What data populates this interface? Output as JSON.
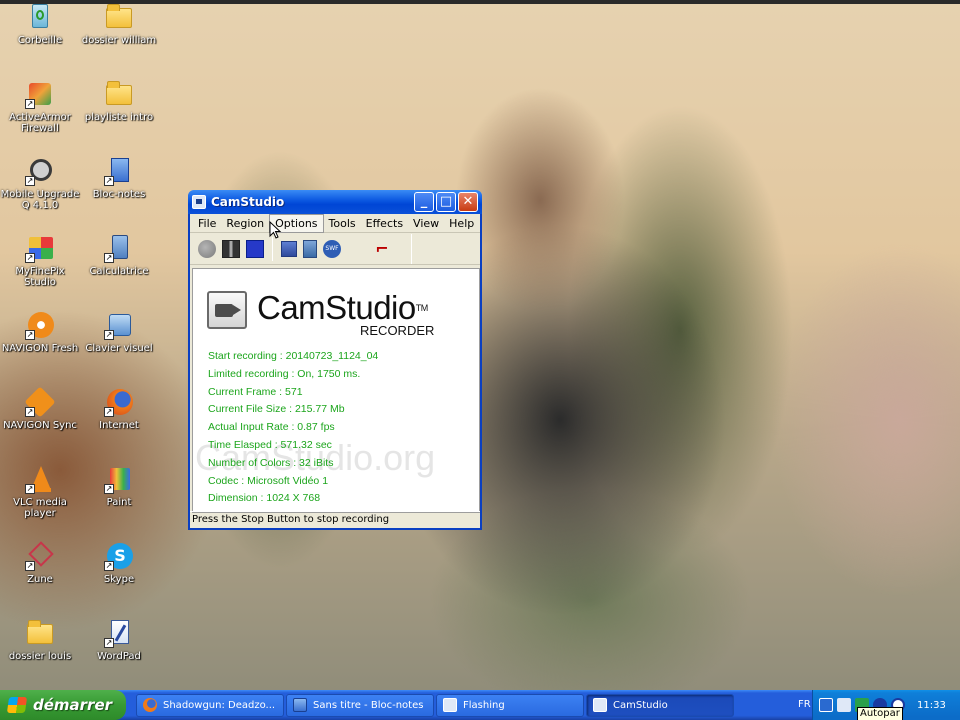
{
  "desktop_icons": [
    {
      "label": "Corbeille",
      "icon": "recycle-bin-icon"
    },
    {
      "label": "dossier william",
      "icon": "folder-icon"
    },
    {
      "label": "ActiveArmor Firewall",
      "icon": "firewall-icon"
    },
    {
      "label": "playliste intro",
      "icon": "folder-icon"
    },
    {
      "label": "Mobile Upgrade Q 4.1.0",
      "icon": "mobile-upgrade-icon"
    },
    {
      "label": "Bloc-notes",
      "icon": "notepad-icon"
    },
    {
      "label": "MyFinePix Studio",
      "icon": "finepix-icon"
    },
    {
      "label": "Calculatrice",
      "icon": "calculator-icon"
    },
    {
      "label": "NAVIGON Fresh",
      "icon": "navigon-fresh-icon"
    },
    {
      "label": "Clavier visuel",
      "icon": "keyboard-icon"
    },
    {
      "label": "NAVIGON Sync",
      "icon": "navigon-sync-icon"
    },
    {
      "label": "Internet",
      "icon": "firefox-icon"
    },
    {
      "label": "VLC media player",
      "icon": "vlc-icon"
    },
    {
      "label": "Paint",
      "icon": "paint-icon"
    },
    {
      "label": "Zune",
      "icon": "zune-icon"
    },
    {
      "label": "Skype",
      "icon": "skype-icon"
    },
    {
      "label": "dossier louis",
      "icon": "folder-icon"
    },
    {
      "label": "WordPad",
      "icon": "wordpad-icon"
    }
  ],
  "window": {
    "title": "CamStudio",
    "menu": [
      "File",
      "Region",
      "Options",
      "Tools",
      "Effects",
      "View",
      "Help"
    ],
    "brand": "CamStudio",
    "brand_tm": "TM",
    "brand_sub": "RECORDER",
    "watermark": "CamStudio.org",
    "stats": [
      "Start recording : 20140723_1124_04",
      "Limited recording : On, 1750 ms.",
      "Current Frame : 571",
      "Current File Size : 215.77 Mb",
      "Actual Input Rate : 0.87 fps",
      "Time Elasped : 571.32 sec",
      "Number of Colors : 32 iBits",
      "Codec : Microsoft Vidéo 1",
      "Dimension : 1024 X 768"
    ],
    "status": "Press the Stop Button to stop recording"
  },
  "taskbar": {
    "start_label": "démarrer",
    "tasks": [
      {
        "label": "Shadowgun: Deadzo...",
        "icon": "firefox-icon"
      },
      {
        "label": "Sans titre - Bloc-notes",
        "icon": "notepad-icon"
      },
      {
        "label": "Flashing",
        "icon": "window-icon"
      },
      {
        "label": "CamStudio",
        "icon": "camstudio-icon"
      }
    ],
    "lang": "FR",
    "clock": "11:33",
    "tooltip": "Autopar"
  }
}
